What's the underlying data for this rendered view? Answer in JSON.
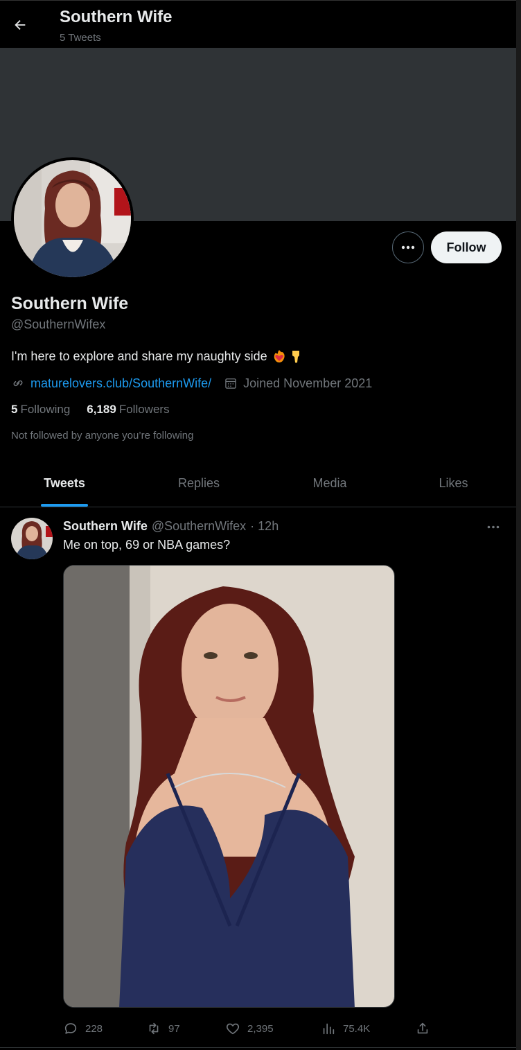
{
  "header": {
    "title": "Southern Wife",
    "subtitle": "5 Tweets"
  },
  "profile": {
    "display_name": "Southern Wife",
    "handle": "@SouthernWifex",
    "bio": "I'm here to explore and share my naughty side",
    "bio_emoji": [
      "fire-heart",
      "pointing-down"
    ],
    "link": "maturelovers.club/SouthernWife/",
    "joined": "Joined November 2021",
    "following_count": "5",
    "following_label": "Following",
    "followers_count": "6,189",
    "followers_label": "Followers",
    "not_followed_text": "Not followed by anyone you’re following"
  },
  "actions": {
    "follow_label": "Follow"
  },
  "tabs": [
    {
      "label": "Tweets",
      "active": true
    },
    {
      "label": "Replies",
      "active": false
    },
    {
      "label": "Media",
      "active": false
    },
    {
      "label": "Likes",
      "active": false
    }
  ],
  "tweet": {
    "author_name": "Southern Wife",
    "author_handle": "@SouthernWifex",
    "time": "· 12h",
    "text": "Me on top, 69 or NBA games?",
    "replies": "228",
    "retweets": "97",
    "likes": "2,395",
    "views": "75.4K"
  },
  "colors": {
    "background": "#000000",
    "banner": "#2f3336",
    "accent": "#1d9bf0",
    "muted": "#71767b",
    "text": "#e7e9ea"
  }
}
